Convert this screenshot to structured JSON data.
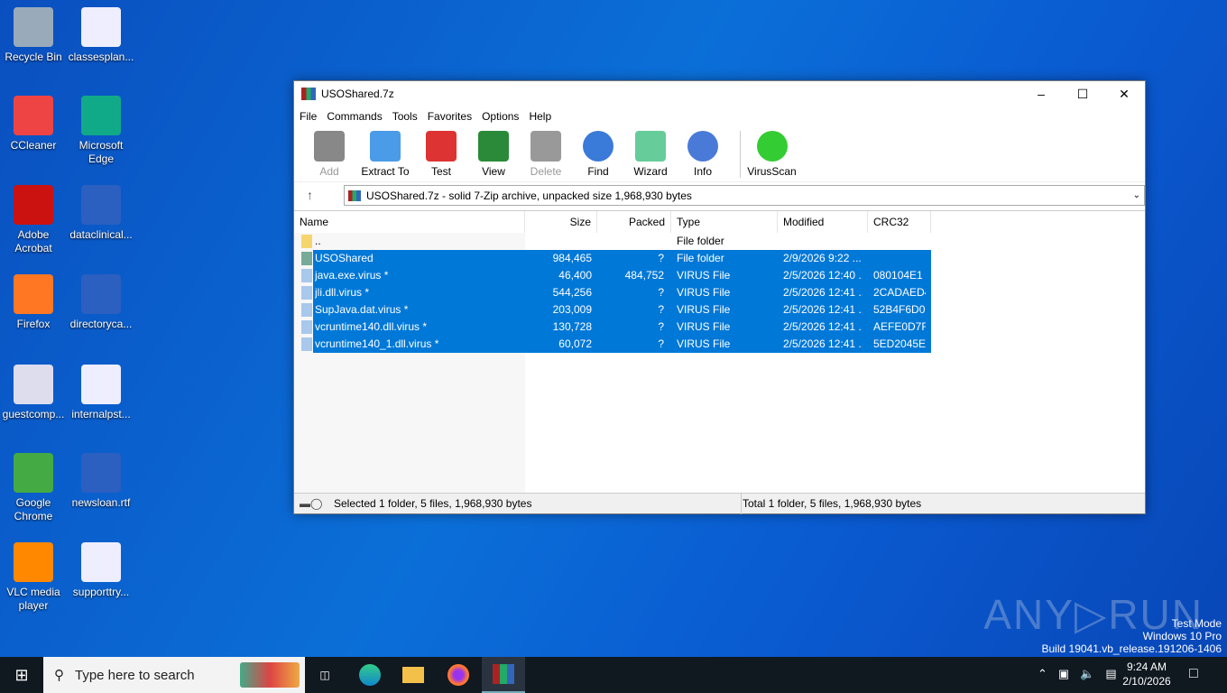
{
  "desktop": {
    "left": [
      "Recycle Bin",
      "CCleaner",
      "Adobe Acrobat",
      "Firefox",
      "guestcomp...",
      "Google Chrome",
      "VLC media player"
    ],
    "right": [
      "classesplan...",
      "Microsoft Edge",
      "dataclinical...",
      "directoryca...",
      "internalpst...",
      "newsloan.rtf",
      "supporttry..."
    ]
  },
  "window": {
    "title": "USOShared.7z",
    "menu": [
      "File",
      "Commands",
      "Tools",
      "Favorites",
      "Options",
      "Help"
    ],
    "toolbar": [
      "Add",
      "Extract To",
      "Test",
      "View",
      "Delete",
      "Find",
      "Wizard",
      "Info",
      "VirusScan"
    ],
    "address": "USOShared.7z - solid 7-Zip archive, unpacked size 1,968,930 bytes",
    "columns": [
      "Name",
      "Size",
      "Packed",
      "Type",
      "Modified",
      "CRC32"
    ],
    "rows": [
      {
        "name": "..",
        "size": "",
        "packed": "",
        "type": "File folder",
        "modified": "",
        "crc": ""
      },
      {
        "name": "USOShared",
        "size": "984,465",
        "packed": "?",
        "type": "File folder",
        "modified": "2/9/2026 9:22 ...",
        "crc": ""
      },
      {
        "name": "java.exe.virus *",
        "size": "46,400",
        "packed": "484,752",
        "type": "VIRUS File",
        "modified": "2/5/2026 12:40 ...",
        "crc": "080104E1"
      },
      {
        "name": "jli.dll.virus *",
        "size": "544,256",
        "packed": "?",
        "type": "VIRUS File",
        "modified": "2/5/2026 12:41 ...",
        "crc": "2CADAED4"
      },
      {
        "name": "SupJava.dat.virus *",
        "size": "203,009",
        "packed": "?",
        "type": "VIRUS File",
        "modified": "2/5/2026 12:41 ...",
        "crc": "52B4F6D0"
      },
      {
        "name": "vcruntime140.dll.virus *",
        "size": "130,728",
        "packed": "?",
        "type": "VIRUS File",
        "modified": "2/5/2026 12:41 ...",
        "crc": "AEFE0D7F"
      },
      {
        "name": "vcruntime140_1.dll.virus *",
        "size": "60,072",
        "packed": "?",
        "type": "VIRUS File",
        "modified": "2/5/2026 12:41 ...",
        "crc": "5ED2045E"
      }
    ],
    "status_left": "Selected 1 folder, 5 files, 1,968,930 bytes",
    "status_right": "Total 1 folder, 5 files, 1,968,930 bytes"
  },
  "taskbar": {
    "search_placeholder": "Type here to search",
    "time": "9:24 AM",
    "date": "2/10/2026"
  },
  "watermark": {
    "logo": "ANY RUN",
    "line1": "Test Mode",
    "line2": "Windows 10 Pro",
    "line3": "Build 19041.vb_release.191206-1406"
  }
}
